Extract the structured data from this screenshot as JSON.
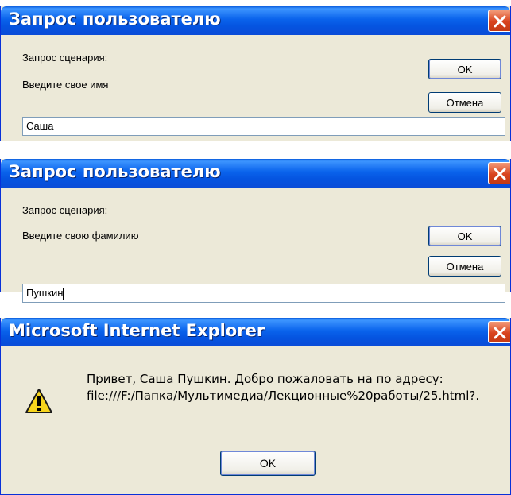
{
  "dialog1": {
    "title": "Запрос пользователю",
    "prompt_header": "Запрос сценария:",
    "prompt_text": "Введите свое имя",
    "ok_label": "OK",
    "cancel_label": "Отмена",
    "input_value": "Саша"
  },
  "dialog2": {
    "title": "Запрос пользователю",
    "prompt_header": "Запрос сценария:",
    "prompt_text": "Введите свою фамилию",
    "ok_label": "OK",
    "cancel_label": "Отмена",
    "input_value": "Пушкин"
  },
  "dialog3": {
    "title": "Microsoft Internet Explorer",
    "message_line1": "Привет, Саша Пушкин.   Добро пожаловать на  по адресу:",
    "message_line2": "file:///F:/Папка/Мультимедиа/Лекционные%20работы/25.html?.",
    "ok_label": "OK",
    "icon": "warning-icon"
  },
  "colors": {
    "titlebar": "#0a5ddd",
    "dialog_bg": "#ece9d8",
    "close": "#d9431e"
  }
}
